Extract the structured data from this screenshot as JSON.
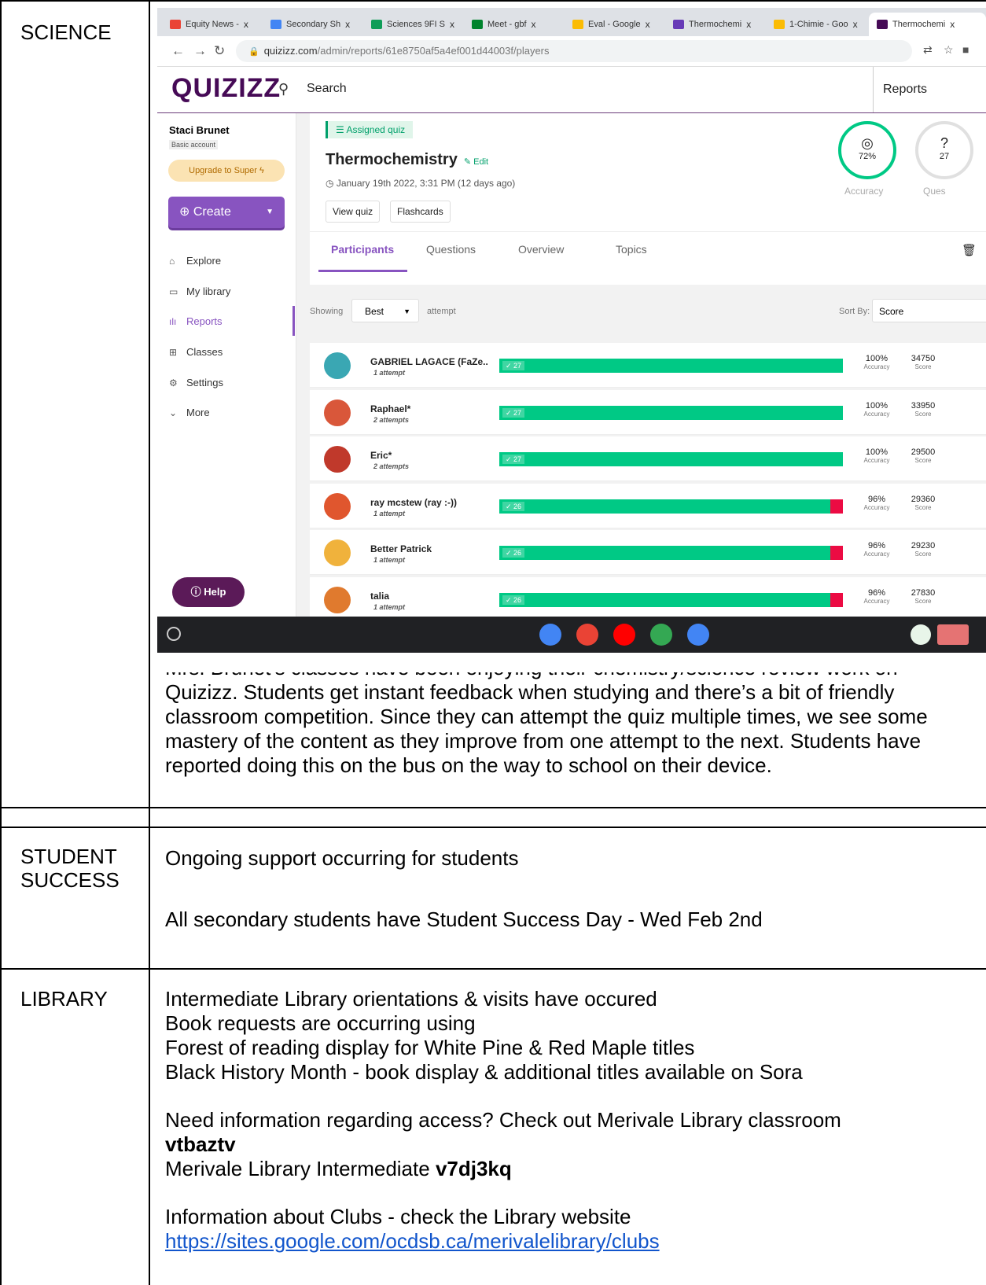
{
  "document": {
    "heading": "",
    "rows": [
      {
        "label": "SCIENCE"
      },
      {
        "label": ""
      },
      {
        "label": "STUDENT SUCCESS"
      },
      {
        "label": "LIBRARY"
      }
    ],
    "science_text": "Mrs. Brunet’s classes have been enjoying their chemistry/science review work on Quizizz. Students get instant feedback when studying and there’s a bit of friendly classroom competition. Since they can attempt the quiz multiple times, we see some mastery of the content as they improve from one attempt to the next. Students have reported doing this on the bus on the way to school on their device.",
    "student_success": {
      "line1": "Ongoing support occurring for students",
      "line2": "All secondary students have Student Success Day - Wed Feb 2nd"
    },
    "library": {
      "lines": [
        "Intermediate Library orientations & visits have occured",
        "Book requests are occurring using",
        "Forest of reading display for White Pine & Red Maple titles",
        "Black History Month - book display & additional titles available on Sora"
      ],
      "access_text": "Need information regarding access? Check out Merivale Library classroom",
      "code1": "vtbaztv",
      "intermediate_text": "Merivale Library Intermediate",
      "code2": "v7dj3kq",
      "clubs_text": "Information about Clubs - check the Library website",
      "clubs_url": "https://sites.google.com/ocdsb.ca/merivalelibrary/clubs"
    }
  },
  "screenshot": {
    "tabs": [
      {
        "label": "Equity News -",
        "color": "#ea4335"
      },
      {
        "label": "Secondary Sh",
        "color": "#4285f4"
      },
      {
        "label": "Sciences 9FI S",
        "color": "#0f9d58"
      },
      {
        "label": "Meet - gbf",
        "color": "#00832d"
      },
      {
        "label": "Eval - Google",
        "color": "#fbbc04"
      },
      {
        "label": "Thermochemi",
        "color": "#673ab7"
      },
      {
        "label": "1-Chimie - Goo",
        "color": "#fbbc04"
      },
      {
        "label": "Thermochemi",
        "color": "#460a56"
      }
    ],
    "tab_close": "x",
    "url_host": "quizizz.com",
    "url_path": "/admin/reports/61e8750af5a4ef001d44003f/players",
    "logo": "QUIZIZZ",
    "search_label": "Search",
    "reports_label": "Reports",
    "user_name": "Staci Brunet",
    "account_type": "Basic account",
    "upgrade_label": "Upgrade to Super",
    "create_label": "Create",
    "nav": [
      {
        "label": "Explore",
        "icon": "explore-icon"
      },
      {
        "label": "My library",
        "icon": "folder-icon"
      },
      {
        "label": "Reports",
        "icon": "reports-icon"
      },
      {
        "label": "Classes",
        "icon": "classes-icon"
      },
      {
        "label": "Settings",
        "icon": "gear-icon"
      },
      {
        "label": "More",
        "icon": "chevron-down-icon"
      }
    ],
    "help_label": "Help",
    "assigned_label": "Assigned quiz",
    "quiz_title": "Thermochemistry",
    "edit_label": "Edit",
    "quiz_date": "January 19th 2022, 3:31 PM (12 days ago)",
    "view_quiz_label": "View quiz",
    "flashcards_label": "Flashcards",
    "accuracy_value": "72%",
    "accuracy_label": "Accuracy",
    "questions_value": "27",
    "questions_label": "Ques",
    "report_tabs": [
      "Participants",
      "Questions",
      "Overview",
      "Topics"
    ],
    "showing_label": "Showing",
    "attempt_select": "Best",
    "attempt_label": "attempt",
    "sortby_label": "Sort By:",
    "sort_select": "Score",
    "accuracy_small": "Accuracy",
    "score_small": "Score",
    "participants": [
      {
        "name": "GABRIEL LAGACE (FaZe...",
        "attempts": "1 attempt",
        "correct": "✓ 27",
        "correct_count": 27,
        "wrong_count": 0,
        "accuracy": "100%",
        "score": "34750",
        "avatar": "#3aa7b3"
      },
      {
        "name": "Raphael*",
        "attempts": "2 attempts",
        "correct": "✓ 27",
        "correct_count": 27,
        "wrong_count": 0,
        "accuracy": "100%",
        "score": "33950",
        "avatar": "#d9573a"
      },
      {
        "name": "Eric*",
        "attempts": "2 attempts",
        "correct": "✓ 27",
        "correct_count": 27,
        "wrong_count": 0,
        "accuracy": "100%",
        "score": "29500",
        "avatar": "#c0392b"
      },
      {
        "name": "ray mcstew (ray :-))",
        "attempts": "1 attempt",
        "correct": "✓ 26",
        "correct_count": 26,
        "wrong_count": 1,
        "accuracy": "96%",
        "score": "29360",
        "avatar": "#e0562e"
      },
      {
        "name": "Better Patrick",
        "attempts": "1 attempt",
        "correct": "✓ 26",
        "correct_count": 26,
        "wrong_count": 1,
        "accuracy": "96%",
        "score": "29230",
        "avatar": "#f0b23c"
      },
      {
        "name": "talia",
        "attempts": "1 attempt",
        "correct": "✓ 26",
        "correct_count": 26,
        "wrong_count": 1,
        "accuracy": "96%",
        "score": "27830",
        "avatar": "#e07a2e"
      }
    ],
    "shelf_colors": [
      "#4285f4",
      "#ea4335",
      "#ff0000",
      "#34a853",
      "#4285f4"
    ]
  }
}
